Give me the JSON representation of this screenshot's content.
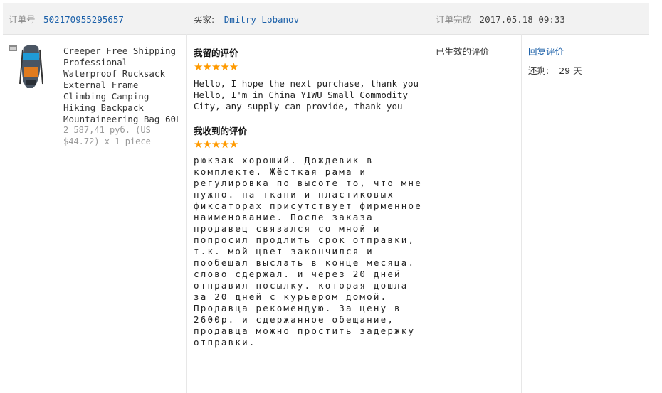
{
  "header": {
    "order_no_label": "订单号",
    "order_no": "502170955295657",
    "buyer_label": "买家:",
    "buyer_name": "Dmitry Lobanov",
    "status_label": "订单完成",
    "date": "2017.05.18 09:33"
  },
  "product": {
    "title": "Creeper Free Shipping Professional Waterproof Rucksack External Frame Climbing Camping Hiking Backpack Mountaineering Bag 60L",
    "price": "2 587,41 руб. (US $44.72) x 1 piece",
    "image_icon": "backpack-thumbnail"
  },
  "my_feedback": {
    "title": "我留的评价",
    "stars": "★★★★★",
    "text": "Hello, I hope the next purchase, thank you Hello, I'm in China YIWU Small Commodity City, any supply can provide, thank you"
  },
  "received_feedback": {
    "title": "我收到的评价",
    "stars": "★★★★★",
    "text": "рюкзак хороший. Дождевик в комплекте. Жёсткая рама и регулировка по высоте то, что мне нужно. на ткани и пластиковых фиксаторах присутствует фирменное наименование. После заказа продавец связался со мной и попросил продлить срок отправки, т.к. мой цвет закончился и пообещал выслать в конце месяца. слово сдержал. и через 20 дней отправил посылку. которая дошла за 20 дней с курьером домой. Продавца рекомендую. За цену в 2600р. и сдержанное обещание, продавца можно простить задержку отправки."
  },
  "status": {
    "text": "已生效的评价"
  },
  "actions": {
    "reply_label": "回复评价",
    "remain_label": "还剩:",
    "remain_value": "29 天"
  },
  "colors": {
    "link": "#1a5fa8",
    "star": "#ff9a00",
    "header_bg": "#f2f2f2"
  }
}
